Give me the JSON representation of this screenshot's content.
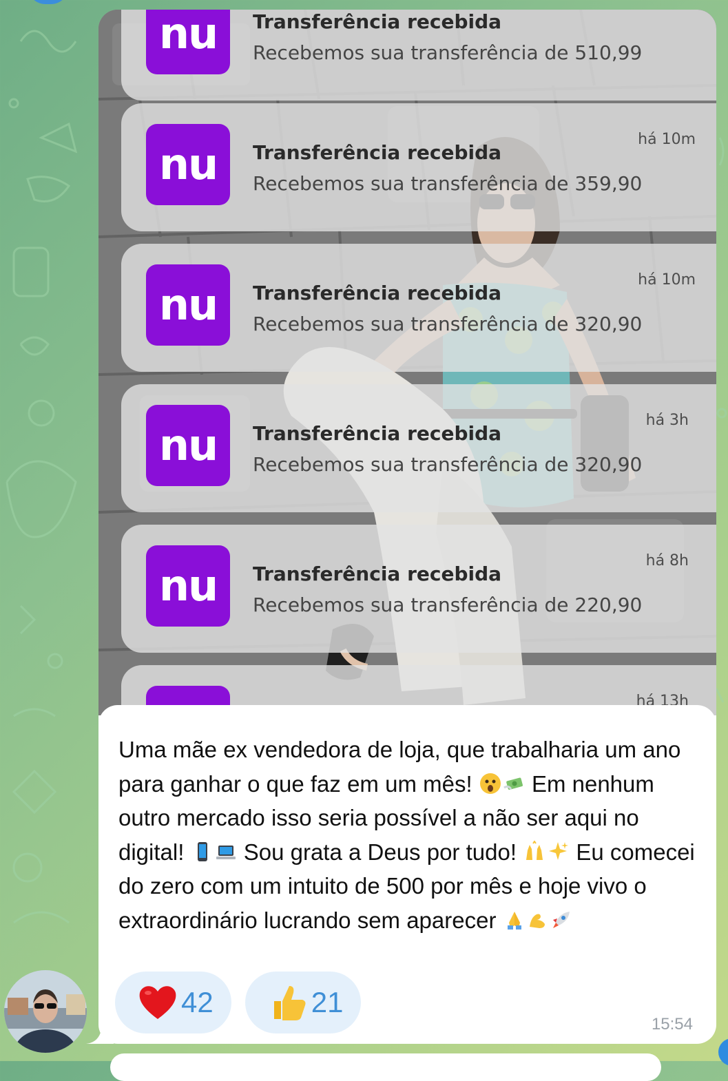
{
  "message": {
    "photo": {
      "notifications": [
        {
          "app_logo": "nu",
          "title": "Transferência recebida",
          "body": "Recebemos sua transferência de 510,99",
          "time": ""
        },
        {
          "app_logo": "nu",
          "title": "Transferência recebida",
          "body": "Recebemos sua transferência de 359,90",
          "time": "há 10m"
        },
        {
          "app_logo": "nu",
          "title": "Transferência recebida",
          "body": "Recebemos sua transferência de 320,90",
          "time": "há 10m"
        },
        {
          "app_logo": "nu",
          "title": "Transferência recebida",
          "body": "Recebemos sua transferência de 320,90",
          "time": "há 3h"
        },
        {
          "app_logo": "nu",
          "title": "Transferência recebida",
          "body": "Recebemos sua transferência de 220,90",
          "time": "há 8h"
        },
        {
          "app_logo": "nu",
          "title": "",
          "body": "",
          "time": "há 13h"
        }
      ]
    },
    "caption": {
      "p1": "Uma mãe ex vendedora de loja, que trabalharia um ano para ganhar o que faz em um mês! ",
      "p2": " Em nenhum outro mercado isso seria possível a não ser aqui no digital! ",
      "p3": " Sou grata a Deus por tudo! ",
      "p4": " Eu comecei do zero com um intuito de 500 por mês e hoje vivo o extraordinário lucrando sem aparecer "
    },
    "reactions": [
      {
        "emoji": "red-heart",
        "count": "42"
      },
      {
        "emoji": "thumbs-up",
        "count": "21"
      }
    ],
    "time": "15:54"
  },
  "colors": {
    "nubank_purple": "#8a0fd8",
    "reaction_count": "#3f8fd6",
    "reaction_bg": "#e4f0fb"
  }
}
